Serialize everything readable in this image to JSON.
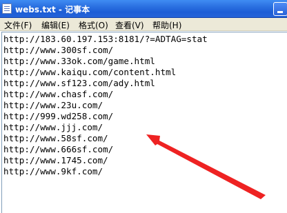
{
  "window": {
    "title": "webs.txt - 记事本"
  },
  "menu": [
    "文件(F)",
    "编辑(E)",
    "格式(O)",
    "查看(V)",
    "帮助(H)"
  ],
  "document": {
    "lines": [
      "http://183.60.197.153:8181/?=ADTAG=stat",
      "http://www.300sf.com/",
      "http://www.33ok.com/game.html",
      "http://www.kaiqu.com/content.html",
      "http://www.sf123.com/ady.html",
      "http://www.chasf.com/",
      "http://www.23u.com/",
      "http://999.wd258.com/",
      "http://www.jjj.com/",
      "http://www.58sf.com/",
      "http://www.666sf.com/",
      "http://www.1745.com/",
      "http://www.9kf.com/"
    ]
  },
  "annotation": {
    "arrow_color": "#ee2222"
  }
}
